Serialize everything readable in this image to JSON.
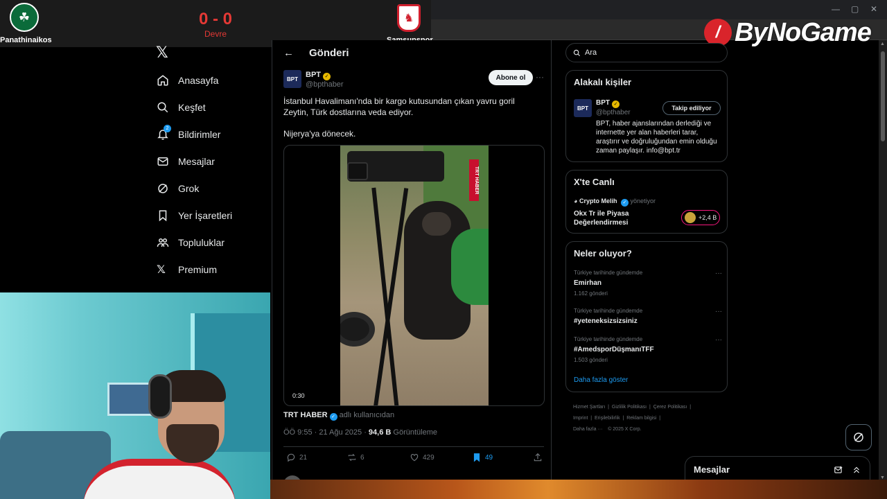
{
  "scoreboard": {
    "home_team": "Panathinaikos",
    "away_team": "Samsunspor",
    "score": "0 - 0",
    "period": "Devre"
  },
  "brand": {
    "name": "ByNoGame"
  },
  "nav": {
    "items": [
      {
        "label": "Anasayfa",
        "icon": "home-icon"
      },
      {
        "label": "Keşfet",
        "icon": "search-icon"
      },
      {
        "label": "Bildirimler",
        "icon": "bell-icon",
        "badge": "2"
      },
      {
        "label": "Mesajlar",
        "icon": "mail-icon"
      },
      {
        "label": "Grok",
        "icon": "grok-icon"
      },
      {
        "label": "Yer İşaretleri",
        "icon": "bookmark-icon"
      },
      {
        "label": "Topluluklar",
        "icon": "communities-icon"
      },
      {
        "label": "Premium",
        "icon": "x-logo-icon"
      }
    ]
  },
  "post": {
    "header_title": "Gönderi",
    "author_name": "BPT",
    "author_handle": "@bpthaber",
    "avatar_text": "BPT",
    "follow_label": "Abone ol",
    "text": "İstanbul Havalimanı'nda bir kargo kutusundan çıkan yavru goril Zeytin, Türk dostlarına veda ediyor.",
    "text2": "Nijerya'ya dönecek.",
    "video_tag": "TRT HABER",
    "video_time": "0:30",
    "source_name": "TRT HABER",
    "source_suffix": "adlı kullanıcıdan",
    "timestamp": "ÖÖ 9:55 · 21 Ağu 2025 ·",
    "views": "94,6 B",
    "views_label": "Görüntüleme",
    "replies": "21",
    "reposts": "6",
    "likes": "429",
    "bookmarks": "49"
  },
  "search": {
    "placeholder": "Ara"
  },
  "related": {
    "title": "Alakalı kişiler",
    "name": "BPT",
    "handle": "@bpthaber",
    "avatar_text": "BPT",
    "button_label": "Takip ediliyor",
    "bio": "BPT, haber ajanslarından derlediği ve internette yer alan haberleri tarar, araştırır ve doğruluğundan emin olduğu zaman paylaşır. info@bpt.tr"
  },
  "live": {
    "title": "X'te Canlı",
    "host": "Crypto Melih",
    "role": "yönetiyor",
    "space_title": "Okx Tr ile Piyasa Değerlendirmesi",
    "listeners": "+2,4 B"
  },
  "trends": {
    "title": "Neler oluyor?",
    "items": [
      {
        "context": "Türkiye tarihinde gündemde",
        "name": "Emirhan",
        "count": "1.162 gönderi"
      },
      {
        "context": "Türkiye tarihinde gündemde",
        "name": "#yeteneksizsizsiniz",
        "count": ""
      },
      {
        "context": "Türkiye tarihinde gündemde",
        "name": "#AmedsporDüşmanıTFF",
        "count": "1.503 gönderi"
      }
    ],
    "show_more": "Daha fazla göster"
  },
  "footer": {
    "links": [
      "Hizmet Şartları",
      "Gizlilik Politikası",
      "Çerez Politikası",
      "Imprint",
      "Erişilebilirlik",
      "Reklam bilgisi",
      "Daha fazla ···",
      "© 2025 X Corp."
    ]
  },
  "messages": {
    "title": "Mesajlar"
  },
  "colors": {
    "accent": "#1d9bf0",
    "brand_red": "#d9242b",
    "score_red": "#e53935"
  }
}
